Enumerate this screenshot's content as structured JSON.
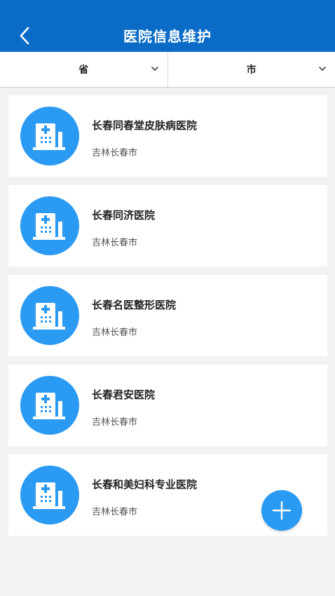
{
  "header": {
    "title": "医院信息维护",
    "back_icon": "chevron-left-icon"
  },
  "filters": {
    "province_label": "省",
    "city_label": "市",
    "dropdown_icon": "chevron-down-icon"
  },
  "hospitals": [
    {
      "name": "长春同春堂皮肤病医院",
      "region": "吉林长春市"
    },
    {
      "name": "长春同济医院",
      "region": "吉林长春市"
    },
    {
      "name": "长春名医整形医院",
      "region": "吉林长春市"
    },
    {
      "name": "长春君安医院",
      "region": "吉林长春市"
    },
    {
      "name": "长春和美妇科专业医院",
      "region": "吉林长春市"
    }
  ],
  "fab": {
    "icon": "plus-icon"
  },
  "colors": {
    "header": "#0a6cc7",
    "accent": "#2b9af3",
    "background": "#f2f2f2"
  }
}
